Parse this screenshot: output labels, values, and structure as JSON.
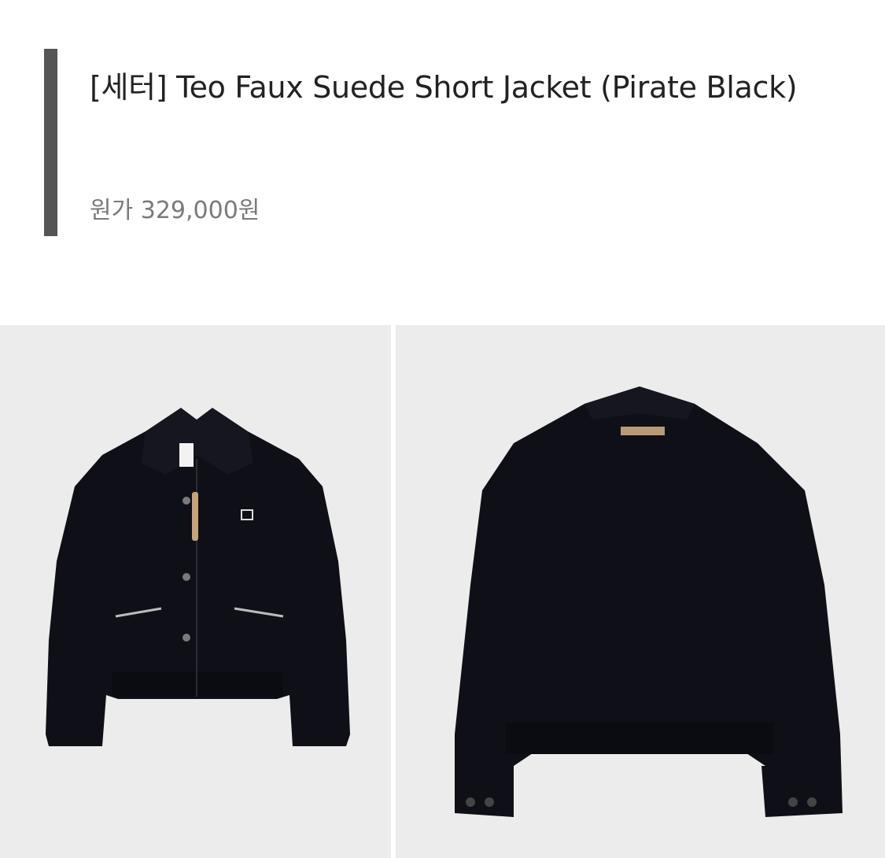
{
  "product": {
    "title": "[세터] Teo Faux Suede Short Jacket (Pirate Black)",
    "price_label": "원가",
    "price": "329,000원"
  },
  "images": [
    {
      "name": "jacket-front",
      "alt": "front view"
    },
    {
      "name": "jacket-back",
      "alt": "back view"
    }
  ],
  "colors": {
    "accent_bar": "#555555",
    "title": "#222222",
    "price": "#7a7a7a",
    "photo_bg": "#ececec",
    "jacket": "#0f1017"
  }
}
